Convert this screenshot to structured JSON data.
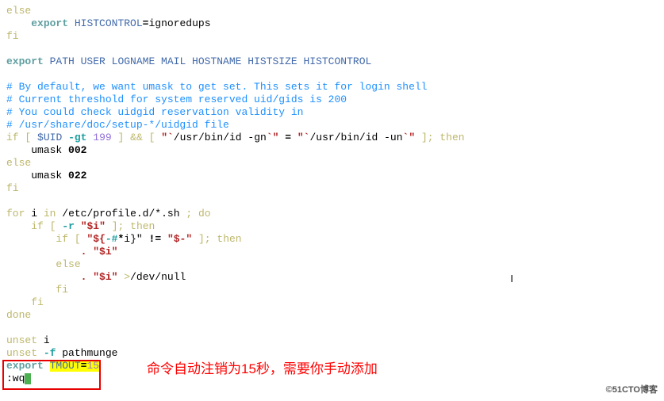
{
  "code": {
    "l1_else": "else",
    "l2_export": "export",
    "l2_var": "HISTCONTROL",
    "l2_eq": "=",
    "l2_val": "ignoredups",
    "l3_fi": "fi",
    "l5_export": "export",
    "l5_vars": "PATH USER LOGNAME MAIL HOSTNAME HISTSIZE HISTCONTROL",
    "c1": "# By default, we want umask to get set. This sets it for login shell",
    "c2": "# Current threshold for system reserved uid/gids is 200",
    "c3": "# You could check uidgid reservation validity in",
    "c4": "# /usr/share/doc/setup-*/uidgid file",
    "if1_if": "if",
    "if1_lb1": "[",
    "if1_uid": "$UID",
    "if1_gt": "-gt",
    "if1_num": "199",
    "if1_rb1": "]",
    "if1_and": "&&",
    "if1_lb2": "[",
    "if1_bt1": "\"`",
    "if1_cmd1": "/usr/bin/id -gn",
    "if1_bt2": "`\"",
    "if1_eq": "=",
    "if1_bt3": "\"`",
    "if1_cmd2": "/usr/bin/id -un",
    "if1_bt4": "`\"",
    "if1_rb2": "]",
    "if1_sc": ";",
    "if1_then": "then",
    "um1": "umask",
    "um1v": "002",
    "else1": "else",
    "um2": "umask",
    "um2v": "022",
    "fi1": "fi",
    "for_for": "for",
    "for_i": "i",
    "for_in": "in",
    "for_path": "/etc/profile.d/*.sh",
    "for_sc": ";",
    "for_do": "do",
    "if2_if": "if",
    "if2_lb": "[",
    "if2_r": "-r",
    "if2_var": "\"$i\"",
    "if2_rb": "]",
    "if2_sc": ";",
    "if2_then": "then",
    "if3_if": "if",
    "if3_lb": "[",
    "if3_s1": "\"${",
    "if3_hash": "-#",
    "if3_star": "*",
    "if3_s2": "i}\"",
    "if3_ne": "!=",
    "if3_dash": "\"$-\"",
    "if3_rb": "]",
    "if3_sc": ";",
    "if3_then": "then",
    "dot1": ".",
    "src1": "\"$i\"",
    "else2": "else",
    "dot2": ".",
    "src2": "\"$i\"",
    "redir": ">",
    "devnull": "/dev/null",
    "fi2": "fi",
    "fi3": "fi",
    "done": "done",
    "unset1": "unset",
    "unset1v": "i",
    "unset2": "unset",
    "unset2f": "-f",
    "unset2v": "pathmunge",
    "exp3": "export",
    "tmout": "TMOUT",
    "tmout_eq": "=",
    "tmout_val": "15",
    "wq": ":wq"
  },
  "annotation": "命令自动注销为15秒，需要你手动添加",
  "watermark": "©51CTO博客"
}
